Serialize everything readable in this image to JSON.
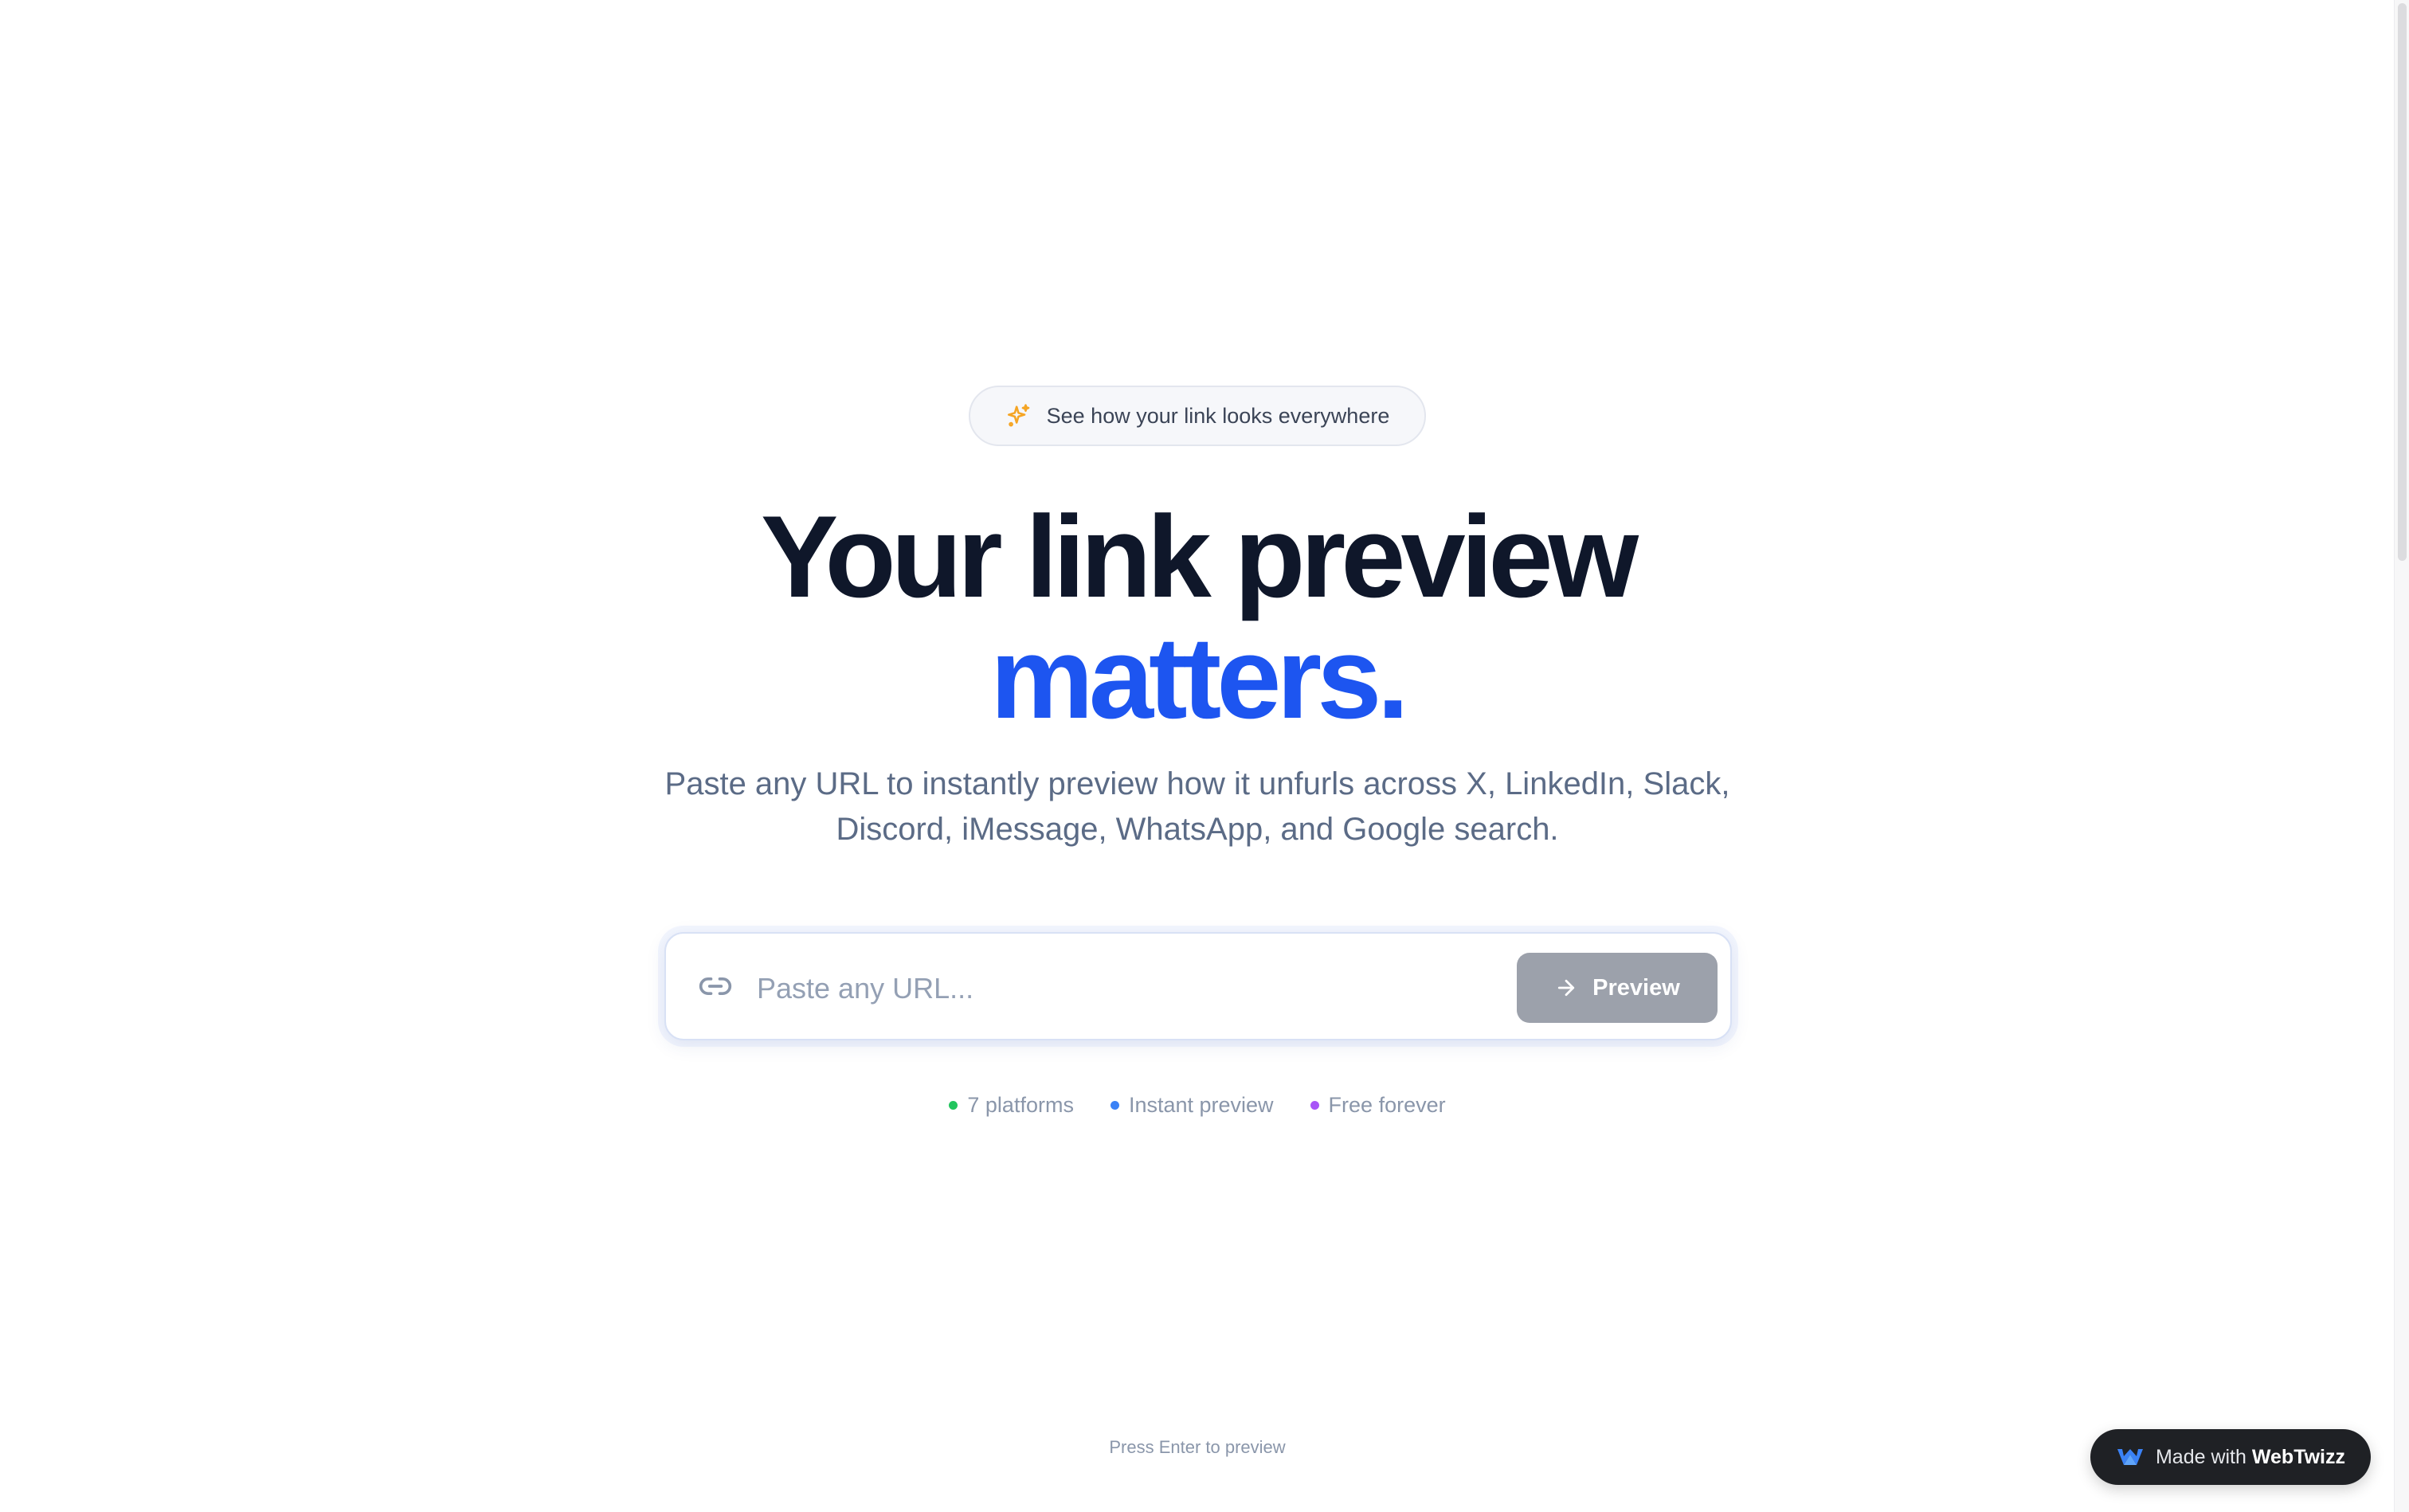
{
  "badge": {
    "icon": "sparkles-icon",
    "text": "See how your link looks everywhere",
    "icon_color": "#f5a524"
  },
  "headline": {
    "line1": "Your link preview",
    "line2": "matters.",
    "line1_color": "#0f172a",
    "line2_color": "#1d55f0"
  },
  "subtitle": "Paste any URL to instantly preview how it unfurls across X, LinkedIn, Slack, Discord, iMessage, WhatsApp, and Google search.",
  "search": {
    "icon": "link-icon",
    "value": "",
    "placeholder": "Paste any URL...",
    "button_label": "Preview",
    "button_icon": "arrow-right-icon",
    "button_color": "#9ca1ab"
  },
  "features": [
    {
      "label": "7 platforms",
      "color": "#22c55e"
    },
    {
      "label": "Instant preview",
      "color": "#3b82f6"
    },
    {
      "label": "Free forever",
      "color": "#a855f7"
    }
  ],
  "hint": "Press Enter to preview",
  "made_with": {
    "prefix": "Made with",
    "brand": "WebTwizz",
    "icon": "webtwizz-logo-icon"
  }
}
